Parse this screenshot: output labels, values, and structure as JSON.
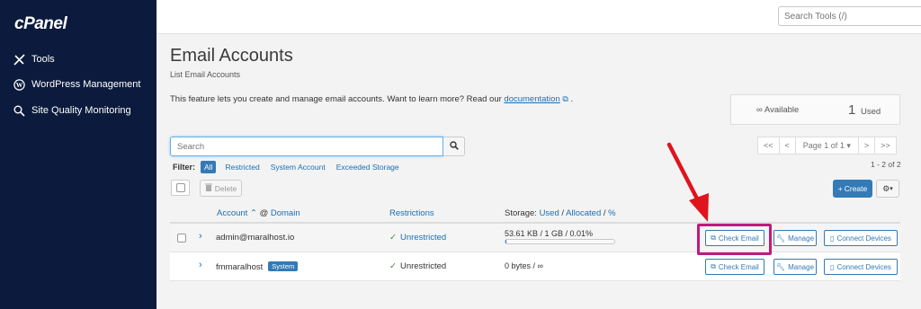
{
  "sidebar": {
    "logo": "cPanel",
    "items": [
      {
        "label": "Tools",
        "icon": "tools-icon"
      },
      {
        "label": "WordPress Management",
        "icon": "wordpress-icon"
      },
      {
        "label": "Site Quality Monitoring",
        "icon": "magnifier-icon"
      }
    ]
  },
  "topbar": {
    "search_placeholder": "Search Tools (/)"
  },
  "page": {
    "title": "Email Accounts",
    "subtitle": "List Email Accounts",
    "intro_text": "This feature lets you create and manage email accounts. Want to learn more? Read our ",
    "intro_link": "documentation",
    "intro_end": "."
  },
  "stats": {
    "available_symbol": "∞",
    "available_label": "Available",
    "used_count": "1",
    "used_label": "Used"
  },
  "search": {
    "placeholder": "Search"
  },
  "pagination": {
    "first": "<<",
    "prev": "<",
    "page_label": "Page 1 of 1 ▾",
    "next": ">",
    "last": ">>",
    "count": "1 - 2 of 2"
  },
  "filter": {
    "label": "Filter:",
    "options": [
      "All",
      "Restricted",
      "System Account",
      "Exceeded Storage"
    ]
  },
  "toolbar": {
    "delete_label": "Delete",
    "create_label": "Create",
    "create_plus": "+"
  },
  "table": {
    "headers": {
      "account": "Account",
      "sort_arrow": "^",
      "at_sign": " @ ",
      "domain": "Domain",
      "restrictions": "Restrictions",
      "storage_prefix": "Storage: ",
      "storage_used": "Used",
      "slash1": " / ",
      "storage_allocated": "Allocated",
      "slash2": " / ",
      "storage_percent": "%"
    },
    "rows": [
      {
        "account": "admin@maralhost.io",
        "badge": "",
        "restriction": "Unrestricted",
        "storage": "53.61 KB / 1 GB / 0.01%",
        "usage_fraction": 0.0001,
        "check_email": "Check Email",
        "manage": "Manage",
        "connect": "Connect Devices"
      },
      {
        "account": "fmmaralhost",
        "badge": "System",
        "restriction": "Unrestricted",
        "storage": "0 bytes / ∞",
        "check_email": "Check Email",
        "manage": "Manage",
        "connect": "Connect Devices"
      }
    ]
  },
  "colors": {
    "sidebar_bg": "#0c1b3d",
    "primary": "#337ab7",
    "highlight": "#c2187f",
    "arrow": "#e0141e"
  }
}
